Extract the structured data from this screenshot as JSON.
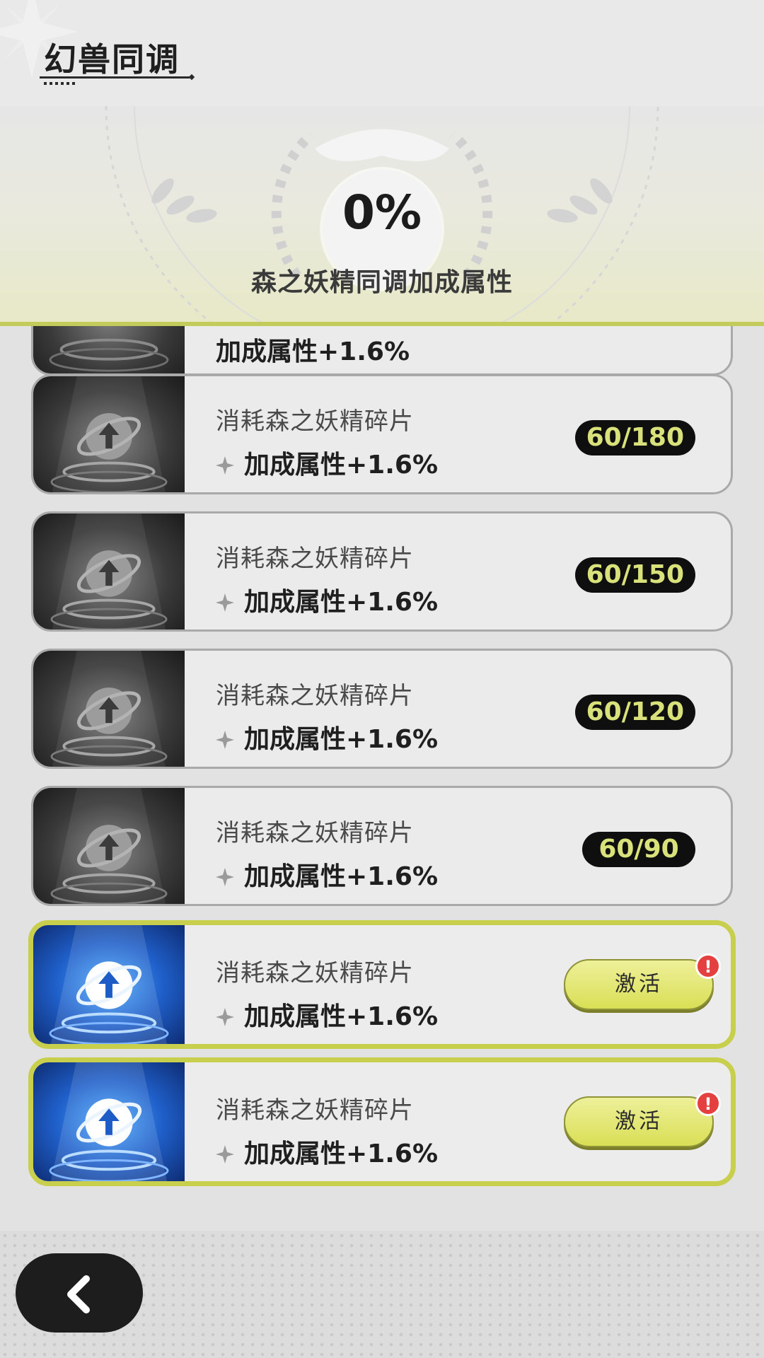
{
  "header": {
    "title": "幻兽同调"
  },
  "banner": {
    "progress_value": "0%",
    "label": "森之妖精同调加成属性"
  },
  "partial_card": {
    "bonus": "加成属性+1.6%"
  },
  "cards": [
    {
      "title": "消耗森之妖精碎片",
      "bonus": "加成属性+1.6%",
      "count": "60/180",
      "state": "locked",
      "icon": "upgrade-arrow-icon"
    },
    {
      "title": "消耗森之妖精碎片",
      "bonus": "加成属性+1.6%",
      "count": "60/150",
      "state": "locked",
      "icon": "upgrade-arrow-icon"
    },
    {
      "title": "消耗森之妖精碎片",
      "bonus": "加成属性+1.6%",
      "count": "60/120",
      "state": "locked",
      "icon": "upgrade-arrow-icon"
    },
    {
      "title": "消耗森之妖精碎片",
      "bonus": "加成属性+1.6%",
      "count": "60/90",
      "state": "locked",
      "icon": "upgrade-arrow-icon"
    },
    {
      "title": "消耗森之妖精碎片",
      "bonus": "加成属性+1.6%",
      "button": "激活",
      "alert": "!",
      "state": "available",
      "icon": "upgrade-arrow-icon"
    },
    {
      "title": "消耗森之妖精碎片",
      "bonus": "加成属性+1.6%",
      "button": "激活",
      "alert": "!",
      "state": "available",
      "icon": "upgrade-arrow-icon"
    }
  ],
  "icons": {
    "back": "chevron-left-icon",
    "bonus": "sparkle-icon",
    "alert": "exclamation-icon"
  },
  "colors": {
    "accent": "#c8cf4c",
    "badge_text": "#d9e27a",
    "badge_bg": "#0f0f0f",
    "alert": "#e3403f",
    "active_thumb": "#1f5fc9"
  }
}
